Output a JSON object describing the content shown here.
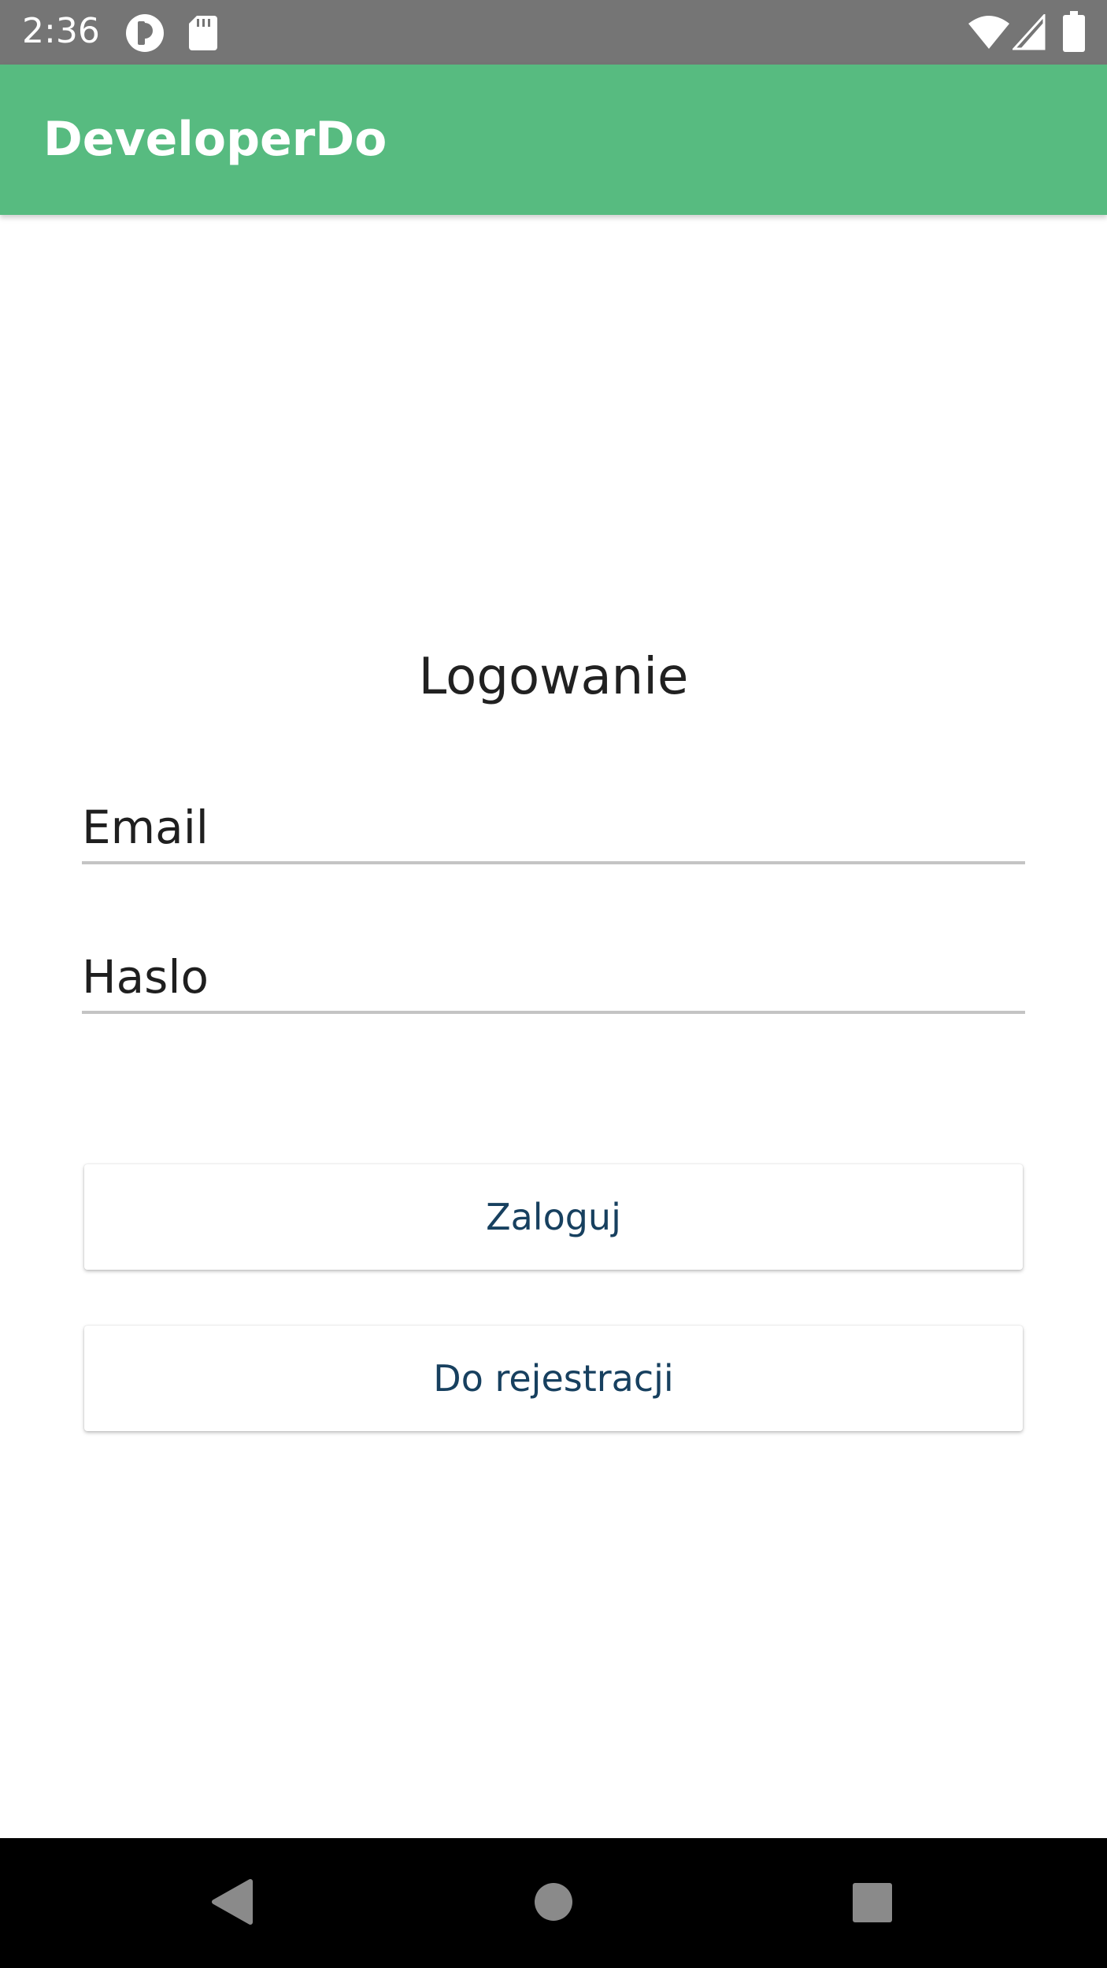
{
  "status_bar": {
    "time": "2:36",
    "icons": [
      "app-notification-icon",
      "sd-card-icon",
      "wifi-icon",
      "cellular-signal-icon",
      "battery-icon"
    ],
    "background": "#757575"
  },
  "app_bar": {
    "title": "DeveloperDo",
    "background": "#57bb80"
  },
  "login": {
    "heading": "Logowanie",
    "email_placeholder": "Email",
    "password_placeholder": "Haslo",
    "login_button": "Zaloguj",
    "register_button": "Do rejestracji",
    "button_text_color": "#17405f"
  },
  "nav_bar": {
    "icons": [
      "back-icon",
      "home-icon",
      "recents-icon"
    ]
  }
}
